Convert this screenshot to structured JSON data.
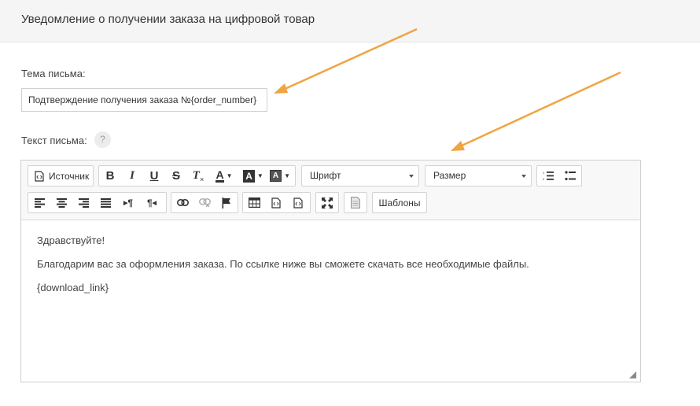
{
  "header": {
    "title": "Уведомление о получении заказа на цифровой товар"
  },
  "subject": {
    "label": "Тема письма:",
    "value": "Подтверждение получения заказа №{order_number}"
  },
  "body_section": {
    "label": "Текст письма:",
    "help": "?"
  },
  "toolbar": {
    "source_label": "Источник",
    "font_label": "Шрифт",
    "size_label": "Размер",
    "templates_label": "Шаблоны",
    "bold": "B",
    "italic": "I",
    "underline": "U",
    "strike": "S",
    "remove_format": "T",
    "text_color": "A",
    "bg_color": "A",
    "ltr": "¶",
    "rtl": "¶"
  },
  "content": {
    "lines": [
      "Здравствуйте!",
      "Благодарим вас за оформления заказа. По ссылке ниже вы сможете скачать все необходимые файлы.",
      "{download_link}"
    ]
  },
  "colors": {
    "arrow": "#f0a443",
    "header_bg": "#f5f5f5"
  }
}
